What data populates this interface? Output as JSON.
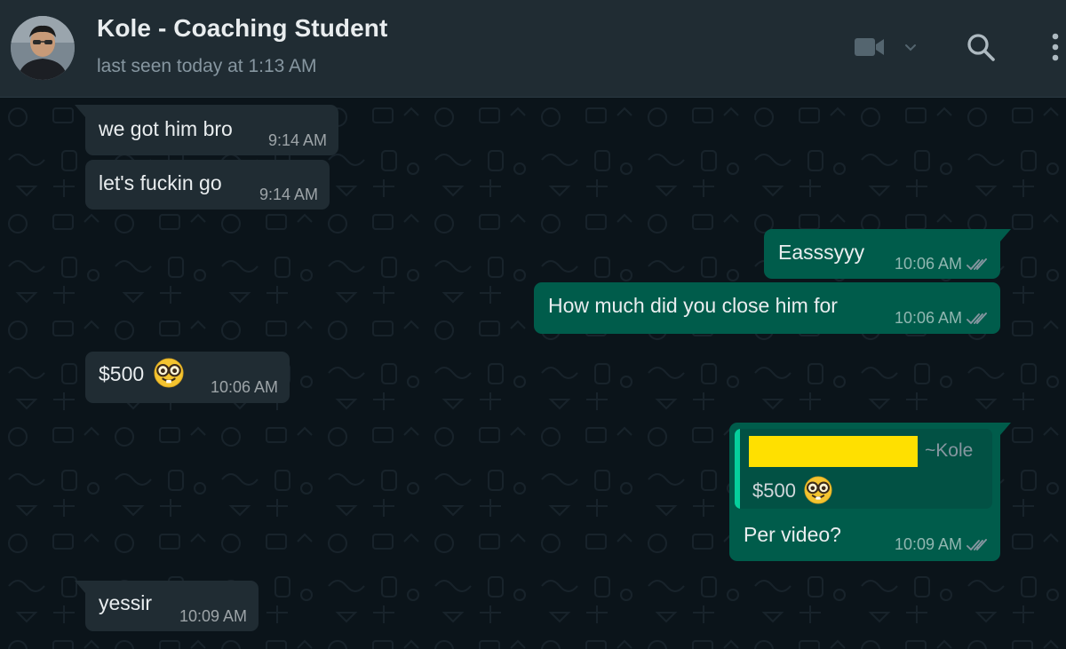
{
  "header": {
    "contact_name": "Kole - Coaching Student",
    "last_seen": "last seen today at 1:13 AM",
    "icons": [
      "video-camera-icon",
      "chevron-down-icon",
      "search-icon",
      "more-vertical-icon"
    ]
  },
  "colors": {
    "header_bg": "#202c33",
    "chat_bg": "#0b141a",
    "incoming_bubble": "#202c33",
    "outgoing_bubble": "#005c4b",
    "quote_accent": "#06cf9c",
    "redaction": "#ffe000",
    "tick_color": "#8696a0"
  },
  "messages": [
    {
      "direction": "in",
      "text": "we got him bro",
      "time": "9:14 AM"
    },
    {
      "direction": "in",
      "text": "let's fuckin go",
      "time": "9:14 AM"
    },
    {
      "direction": "out",
      "text": "Easssyyy",
      "time": "10:06 AM",
      "status_icon": "double-check-icon"
    },
    {
      "direction": "out",
      "text": "How much did you close him for",
      "time": "10:06 AM",
      "status_icon": "double-check-icon"
    },
    {
      "direction": "in",
      "text": "$500",
      "emoji": "nerd-face-emoji",
      "time": "10:06 AM"
    },
    {
      "direction": "out",
      "quote": {
        "author": "~Kole",
        "text": "$500",
        "emoji": "nerd-face-emoji"
      },
      "text": "Per video?",
      "time": "10:09 AM",
      "status_icon": "double-check-icon"
    },
    {
      "direction": "in",
      "text": "yessir",
      "time": "10:09 AM"
    }
  ]
}
